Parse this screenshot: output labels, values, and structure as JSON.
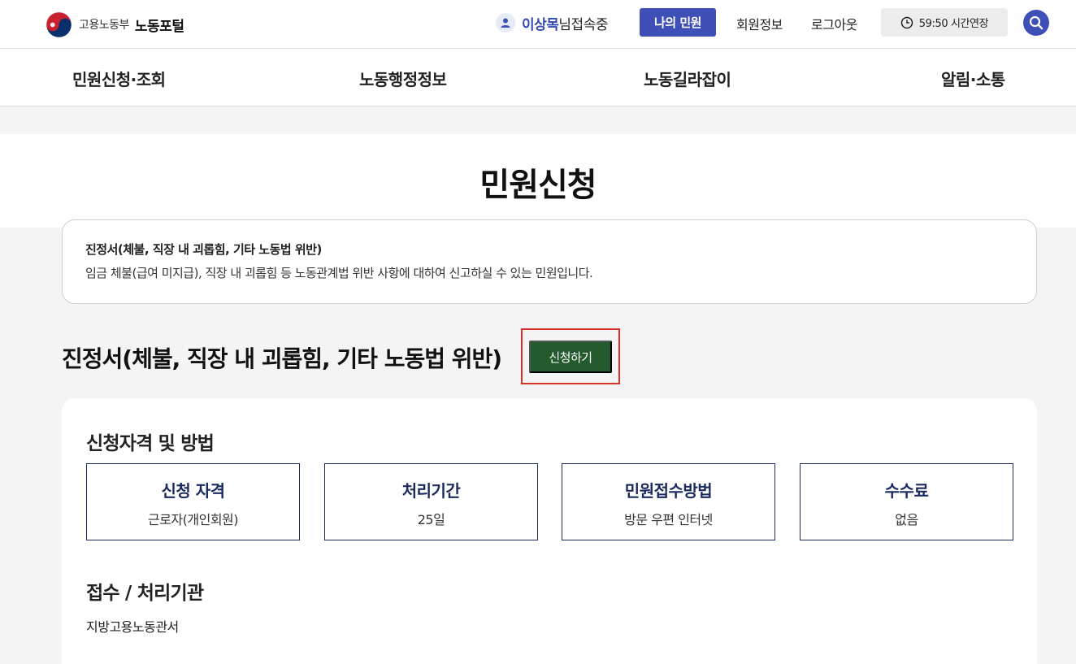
{
  "header": {
    "org_name": "고용노동부",
    "portal_name": "노동포털",
    "user_name": "이상목",
    "user_suffix": "님접속중",
    "my_civil_label": "나의 민원",
    "member_info_label": "회원정보",
    "logout_label": "로그아웃",
    "timer_label": "59:50 시간연장"
  },
  "gnb": {
    "items": [
      {
        "label": "민원신청·조회"
      },
      {
        "label": "노동행정정보"
      },
      {
        "label": "노동길라잡이"
      },
      {
        "label": "알림·소통"
      }
    ]
  },
  "page": {
    "title": "민원신청"
  },
  "summary": {
    "title": "진정서(체불, 직장 내 괴롭힘, 기타 노동법 위반)",
    "description": "임금 체불(급여 미지급), 직장 내 괴롭힘 등 노동관계법 위반 사항에 대하여 신고하실 수 있는 민원입니다."
  },
  "section": {
    "heading": "진정서(체불, 직장 내 괴롭힘, 기타 노동법 위반)",
    "apply_label": "신청하기"
  },
  "detail": {
    "qualification_heading": "신청자격 및 방법",
    "info_boxes": [
      {
        "label": "신청 자격",
        "value": "근로자(개인회원)"
      },
      {
        "label": "처리기간",
        "value": "25일"
      },
      {
        "label": "민원접수방법",
        "value": "방문 우편 인터넷"
      },
      {
        "label": "수수료",
        "value": "없음"
      }
    ],
    "agency_heading": "접수 / 처리기관",
    "agency_value": "지방고용노동관서"
  },
  "colors": {
    "primary_blue": "#3e4fb8",
    "apply_green": "#245b2e",
    "highlight_red": "#d9302c",
    "navy_border": "#1b2a5e"
  }
}
